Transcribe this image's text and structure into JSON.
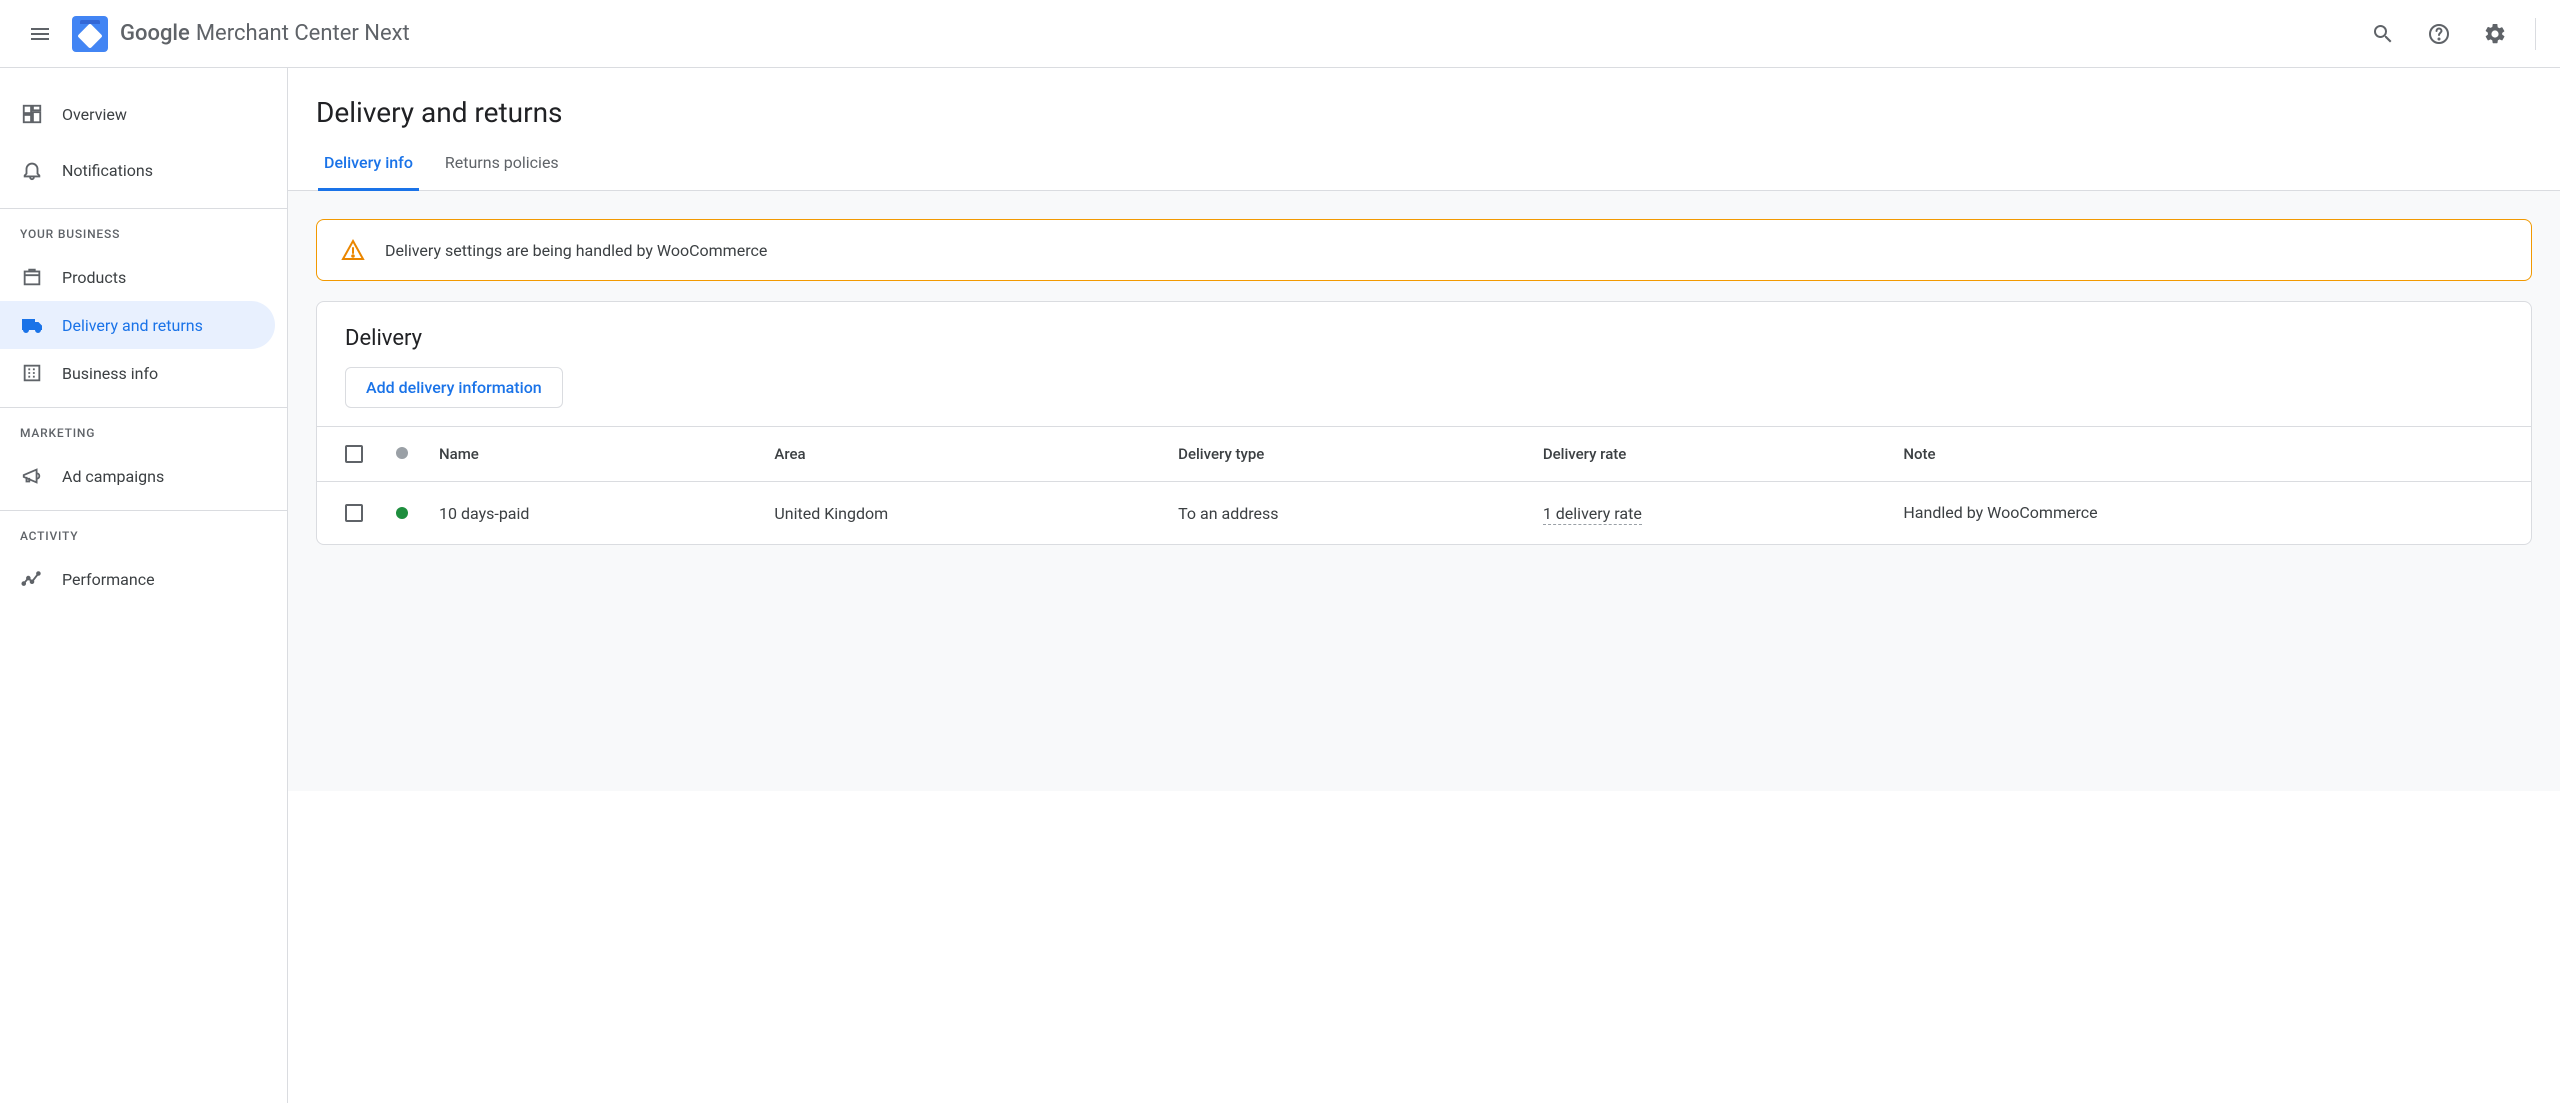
{
  "header": {
    "brand_google": "Google",
    "brand_product": "Merchant Center Next"
  },
  "sidebar": {
    "overview": "Overview",
    "notifications": "Notifications",
    "section_business": "YOUR BUSINESS",
    "products": "Products",
    "delivery_returns": "Delivery and returns",
    "business_info": "Business info",
    "section_marketing": "MARKETING",
    "ad_campaigns": "Ad campaigns",
    "section_activity": "ACTIVITY",
    "performance": "Performance"
  },
  "page": {
    "title": "Delivery and returns",
    "tabs": {
      "delivery_info": "Delivery info",
      "returns_policies": "Returns policies"
    },
    "alert": "Delivery settings are being handled by WooCommerce",
    "card_title": "Delivery",
    "add_button": "Add delivery information",
    "columns": {
      "name": "Name",
      "area": "Area",
      "delivery_type": "Delivery type",
      "delivery_rate": "Delivery rate",
      "note": "Note"
    },
    "rows": [
      {
        "name": "10 days-paid",
        "area": "United Kingdom",
        "delivery_type": "To an address",
        "delivery_rate": "1 delivery rate",
        "note": "Handled by WooCommerce"
      }
    ]
  }
}
